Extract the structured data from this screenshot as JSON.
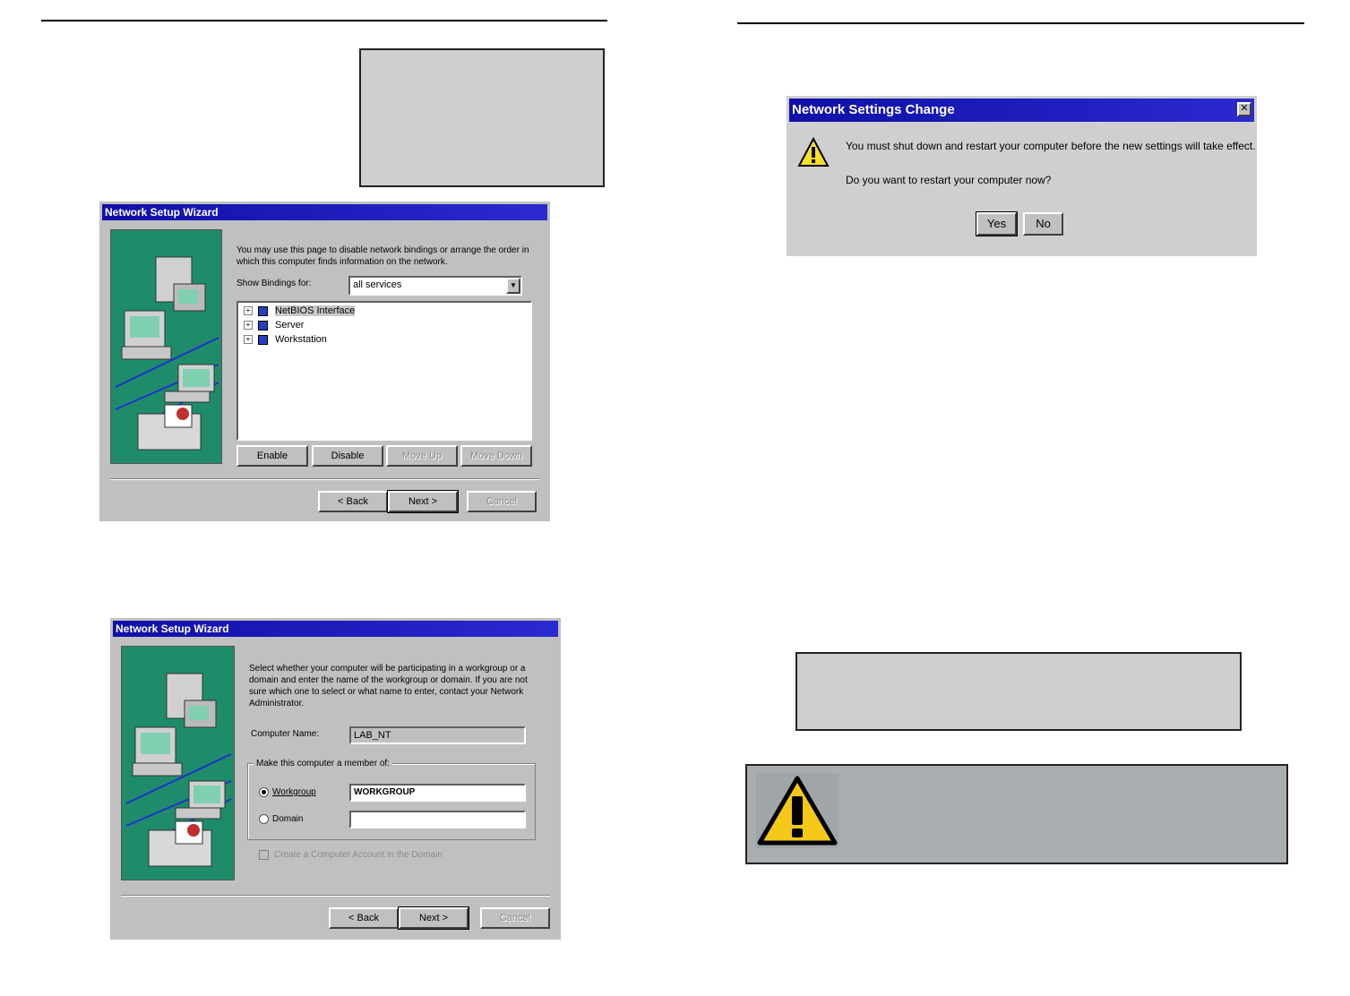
{
  "dialog_binding": {
    "title": "Network Setup Wizard",
    "description": "You may use this page to disable network bindings or arrange the order in which this computer finds information on the network.",
    "show_bindings_label": "Show Bindings for:",
    "show_bindings_value": "all services",
    "tree_items": [
      "NetBIOS Interface",
      "Server",
      "Workstation"
    ],
    "buttons": {
      "enable": "Enable",
      "disable": "Disable",
      "move_up": "Move Up",
      "move_down": "Move Down",
      "back": "< Back",
      "next": "Next >",
      "cancel": "Cancel"
    }
  },
  "dialog_workgroup": {
    "title": "Network Setup Wizard",
    "description": "Select whether your computer will be participating in a workgroup or a domain and enter the name of the workgroup or domain. If you are not sure which one to select or what name to enter, contact your Network Administrator.",
    "computer_name_label": "Computer Name:",
    "computer_name_value": "LAB_NT",
    "member_of_label": "Make this computer a member of:",
    "workgroup_label": "Workgroup",
    "workgroup_value": "WORKGROUP",
    "domain_label": "Domain",
    "domain_value": "",
    "create_account_label": "Create a Computer Account in the Domain",
    "buttons": {
      "back": "< Back",
      "next": "Next >",
      "cancel": "Cancel"
    }
  },
  "dialog_restart": {
    "title": "Network Settings Change",
    "message": "You must shut down and restart your computer before the new settings will take effect.",
    "question": "Do you want to restart your computer now?",
    "yes_label": "Yes",
    "no_label": "No"
  },
  "icons": {
    "caution": "caution-triangle-icon",
    "warning": "warning-triangle-icon",
    "close": "close-icon"
  }
}
